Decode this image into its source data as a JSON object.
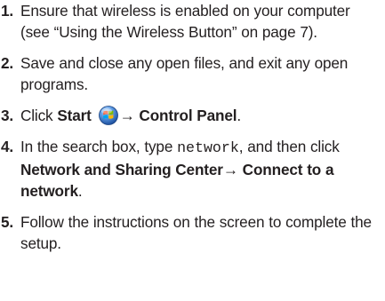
{
  "steps": [
    {
      "number": "1",
      "text_1": "Ensure that wireless is enabled on your computer (see “Using the Wireless Button” on page 7)."
    },
    {
      "number": "2",
      "text_1": "Save and close any open files, and exit any open programs."
    },
    {
      "number": "3",
      "text_1": "Click ",
      "bold_1": "Start",
      "icon": "windows-start-orb-icon",
      "bold_2": "→ Control Panel",
      "text_2": "."
    },
    {
      "number": "4",
      "text_1": "In the search box, type ",
      "code": "network",
      "text_2": ", and then click ",
      "bold_1": "Network and Sharing Center→ Connect to a network",
      "text_3": "."
    },
    {
      "number": "5",
      "text_1": "Follow the instructions on the screen to complete the setup."
    }
  ],
  "colors": {
    "text": "#231f20",
    "orb_blue": "#2f6fc9",
    "flag_red": "#f25022",
    "flag_green": "#7fba00",
    "flag_blue": "#00a4ef",
    "flag_yellow": "#ffb900"
  }
}
